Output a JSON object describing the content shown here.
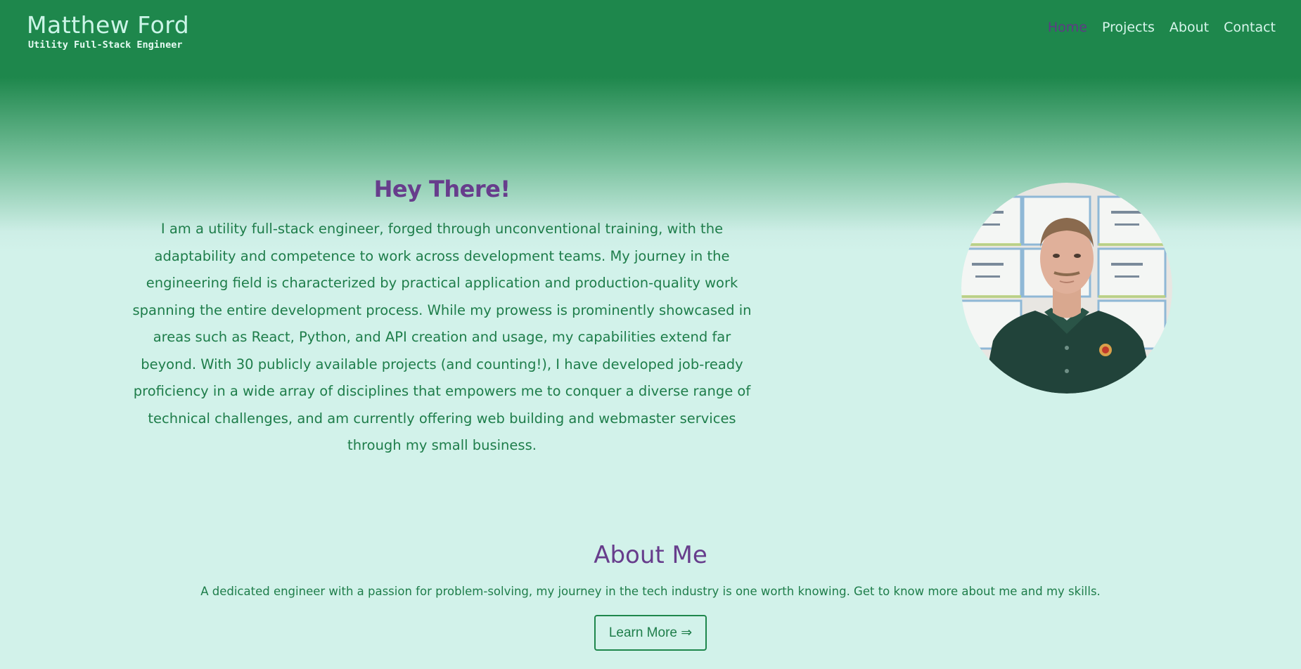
{
  "header": {
    "name": "Matthew Ford",
    "tagline": "Utility Full-Stack Engineer",
    "nav": [
      "Home",
      "Projects",
      "About",
      "Contact"
    ],
    "active_nav": "Home"
  },
  "hero": {
    "title": "Hey There!",
    "body": "I am a utility full-stack engineer, forged through unconventional training, with the adaptability and competence to work across development teams. My journey in the engineering field is characterized by practical application and production-quality work spanning the entire development process. While my prowess is prominently showcased in areas such as React, Python, and API creation and usage, my capabilities extend far beyond. With 30 publicly available projects (and counting!), I have developed job-ready proficiency in a wide array of disciplines that empowers me to conquer a diverse range of technical challenges, and am currently offering web building and webmaster services through my small business."
  },
  "about": {
    "title": "About Me",
    "text": "A dedicated engineer with a passion for problem-solving, my journey in the tech industry is one worth knowing. Get to know more about me and my skills.",
    "button": "Learn More ⇒"
  },
  "colors": {
    "header_green": "#1e874c",
    "page_mint": "#d2f2ea",
    "accent_purple": "#673d8c",
    "text_green": "#1e7d4a"
  }
}
